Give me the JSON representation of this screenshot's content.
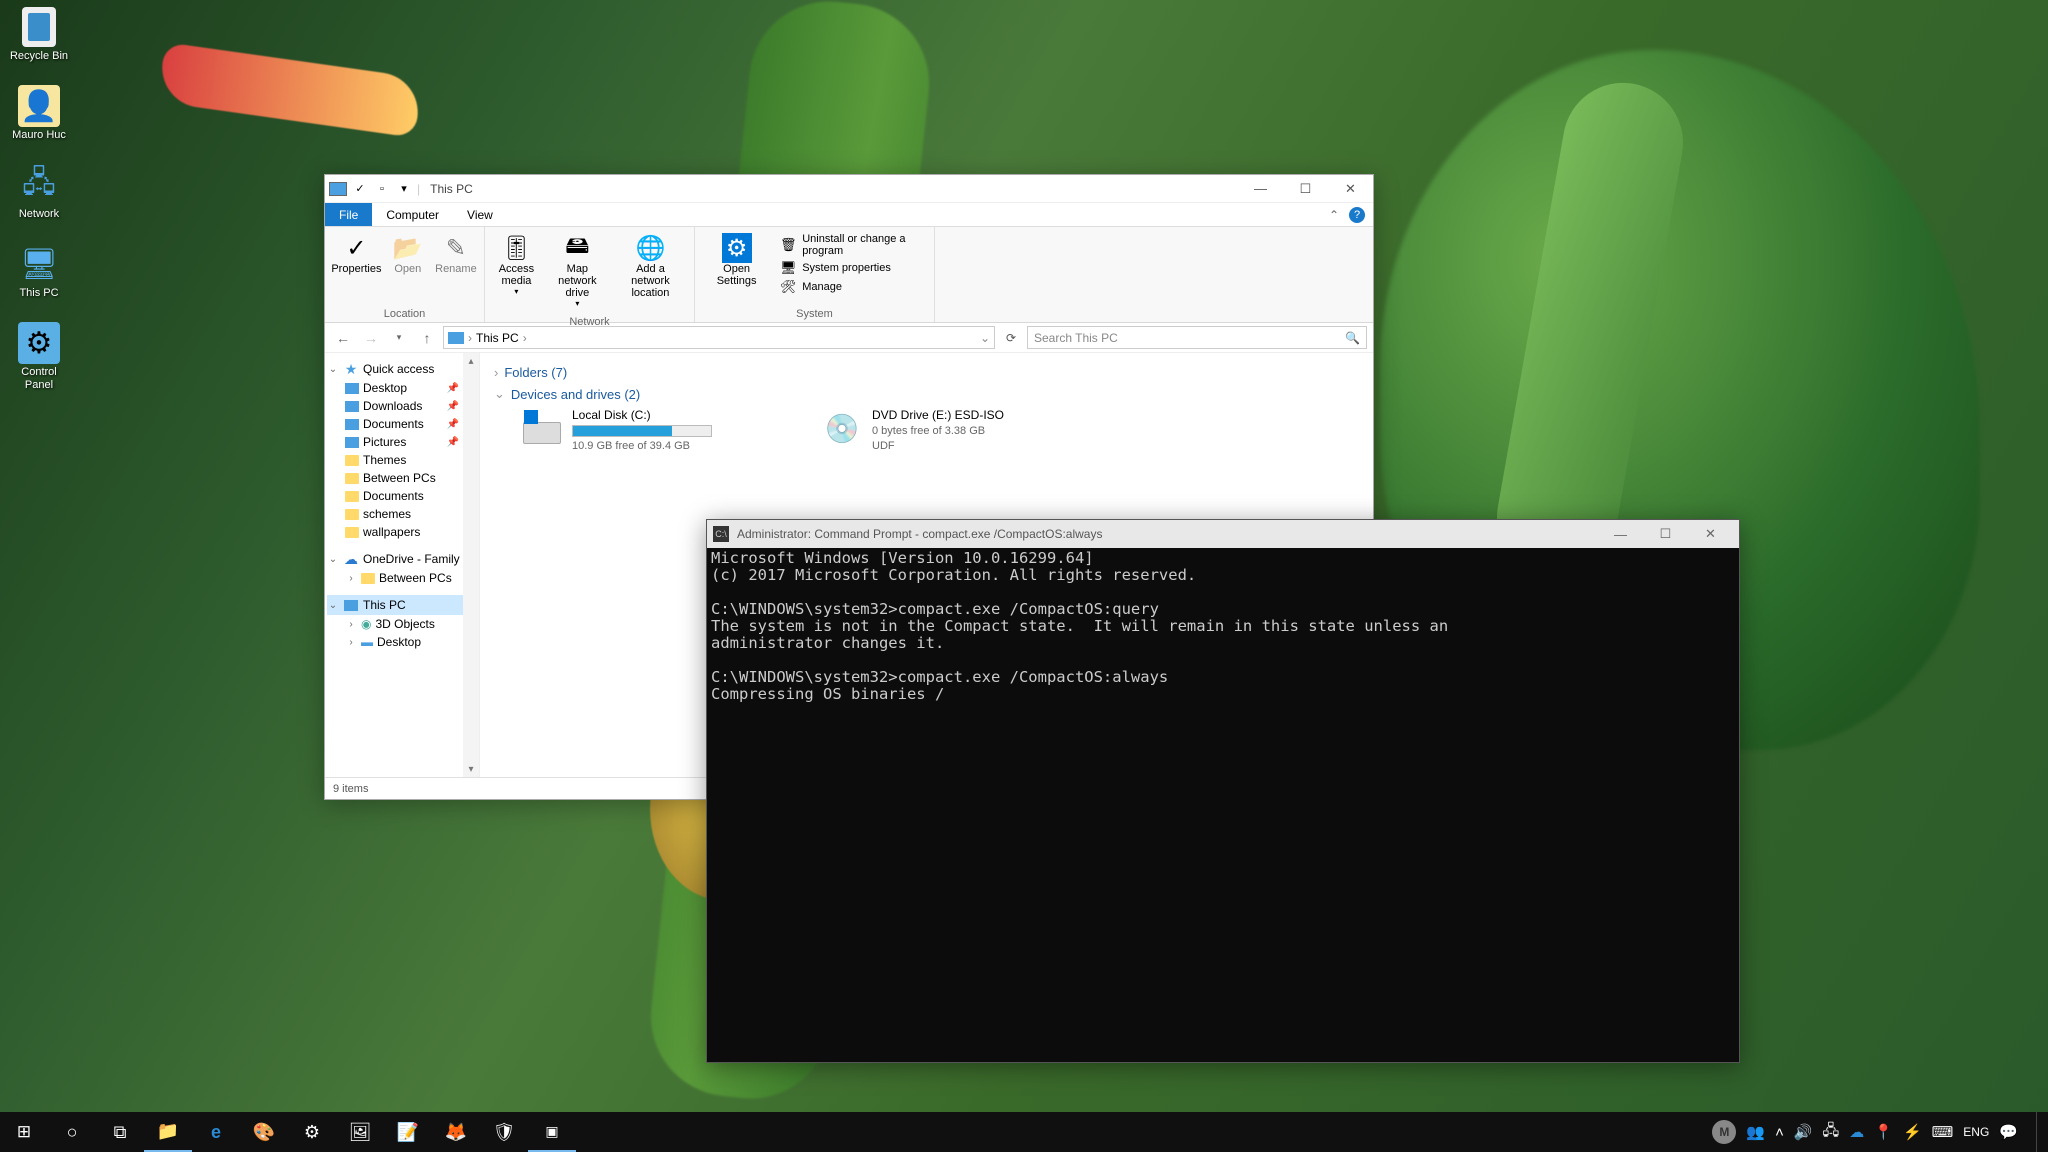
{
  "desktop": {
    "icons": [
      "Recycle Bin",
      "Mauro Huc",
      "Network",
      "This PC",
      "Control Panel"
    ]
  },
  "explorer": {
    "title": "This PC",
    "tabs": {
      "file": "File",
      "computer": "Computer",
      "view": "View"
    },
    "ribbon": {
      "location": {
        "group": "Location",
        "properties": "Properties",
        "open": "Open",
        "rename": "Rename"
      },
      "network": {
        "group": "Network",
        "access": "Access media",
        "map": "Map network drive",
        "add": "Add a network location"
      },
      "system": {
        "group": "System",
        "open_settings": "Open Settings",
        "uninstall": "Uninstall or change a program",
        "sysprops": "System properties",
        "manage": "Manage"
      }
    },
    "address": {
      "path": "This PC",
      "search_placeholder": "Search This PC"
    },
    "nav": {
      "quick": "Quick access",
      "quick_items": [
        "Desktop",
        "Downloads",
        "Documents",
        "Pictures",
        "Themes",
        "Between PCs",
        "Documents",
        "schemes",
        "wallpapers"
      ],
      "onedrive": "OneDrive - Family",
      "onedrive_items": [
        "Between PCs"
      ],
      "thispc": "This PC",
      "thispc_items": [
        "3D Objects",
        "Desktop"
      ]
    },
    "content": {
      "folders_header": "Folders (7)",
      "drives_header": "Devices and drives (2)",
      "local": {
        "name": "Local Disk (C:)",
        "free": "10.9 GB free of 39.4 GB",
        "fill_pct": 72
      },
      "dvd": {
        "name": "DVD Drive (E:) ESD-ISO",
        "free": "0 bytes free of 3.38 GB",
        "fs": "UDF"
      }
    },
    "status": "9 items"
  },
  "terminal": {
    "title": "Administrator: Command Prompt - compact.exe  /CompactOS:always",
    "lines": [
      "Microsoft Windows [Version 10.0.16299.64]",
      "(c) 2017 Microsoft Corporation. All rights reserved.",
      "",
      "C:\\WINDOWS\\system32>compact.exe /CompactOS:query",
      "The system is not in the Compact state.  It will remain in this state unless an",
      "administrator changes it.",
      "",
      "C:\\WINDOWS\\system32>compact.exe /CompactOS:always",
      "Compressing OS binaries /"
    ]
  },
  "taskbar": {
    "user_initial": "M",
    "lang": "ENG"
  }
}
